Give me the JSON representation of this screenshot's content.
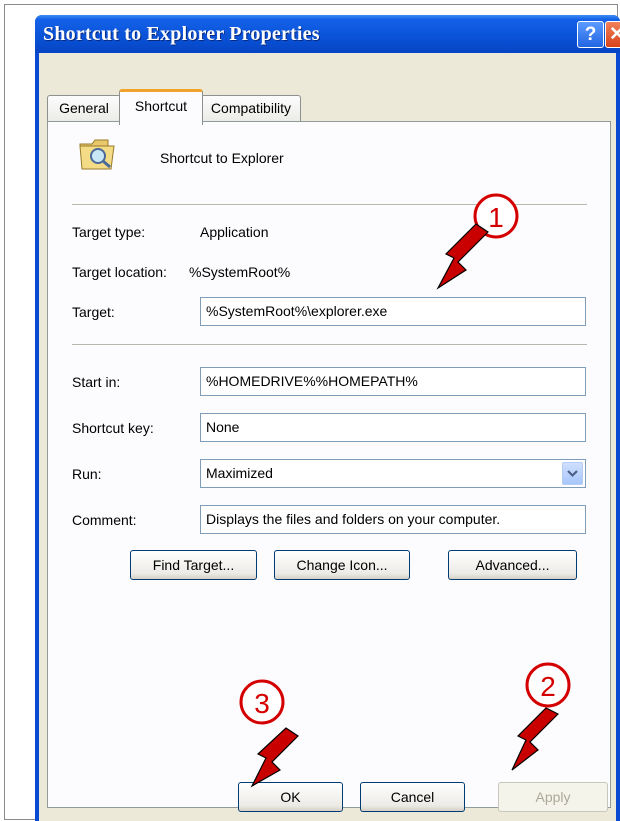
{
  "window": {
    "title": "Shortcut to Explorer Properties",
    "help_glyph": "?",
    "close_glyph": "✕"
  },
  "tabs": [
    {
      "label": "General"
    },
    {
      "label": "Shortcut"
    },
    {
      "label": "Compatibility"
    }
  ],
  "shortcut": {
    "name": "Shortcut to Explorer",
    "target_type_label": "Target type:",
    "target_type_value": "Application",
    "target_location_label": "Target location:",
    "target_location_value": "%SystemRoot%",
    "target_label": "Target:",
    "target_value": "%SystemRoot%\\explorer.exe",
    "start_in_label": "Start in:",
    "start_in_value": "%HOMEDRIVE%%HOMEPATH%",
    "shortcut_key_label": "Shortcut key:",
    "shortcut_key_value": "None",
    "run_label": "Run:",
    "run_value": "Maximized",
    "comment_label": "Comment:",
    "comment_value": "Displays the files and folders on your computer."
  },
  "buttons": {
    "find_target": "Find Target...",
    "change_icon": "Change Icon...",
    "advanced": "Advanced...",
    "ok": "OK",
    "cancel": "Cancel",
    "apply": "Apply"
  },
  "annotations": {
    "one": "1",
    "two": "2",
    "three": "3"
  },
  "colors": {
    "annotation_red": "#d40000",
    "title_blue": "#0a53d8",
    "dialog_bg": "#ece9d8"
  }
}
